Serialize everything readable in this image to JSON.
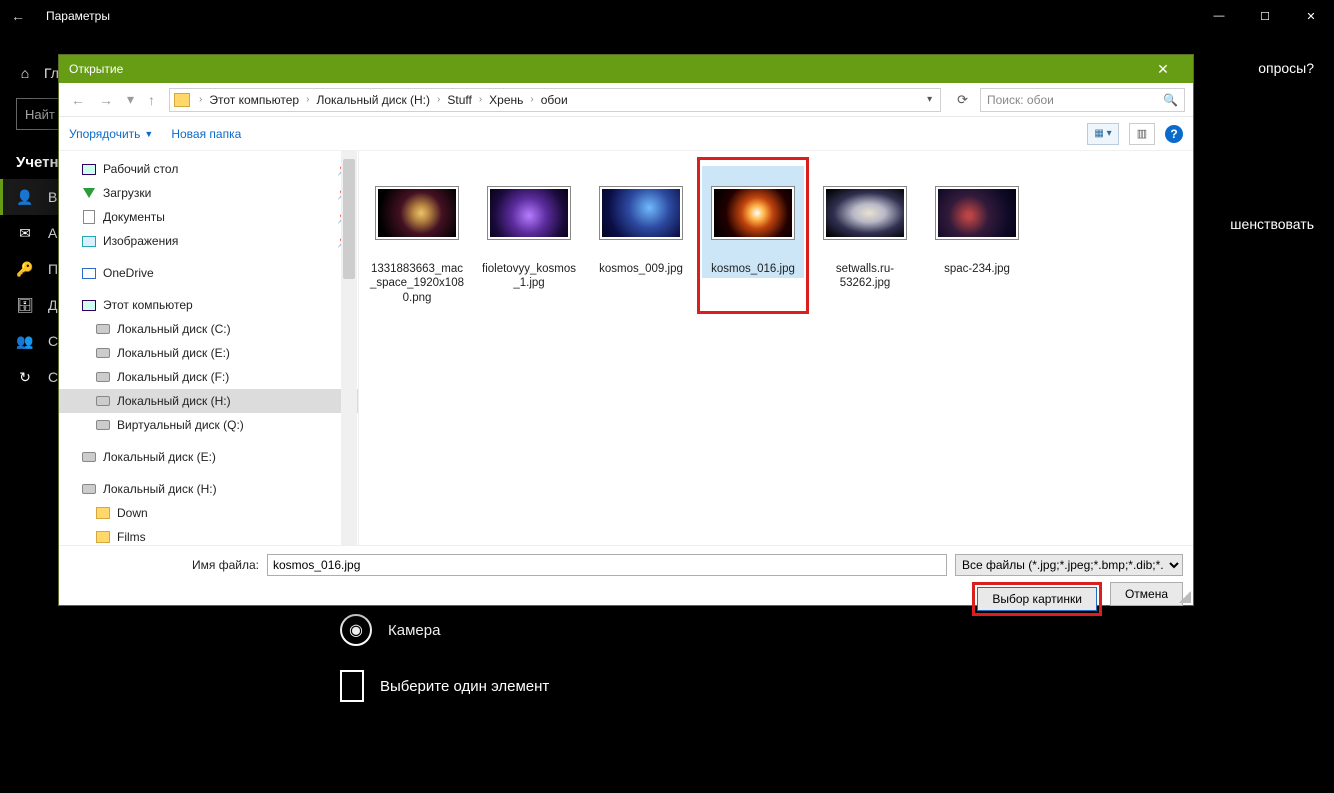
{
  "settings": {
    "window_title": "Параметры",
    "home_label": "Гл",
    "find_placeholder": "Найт",
    "section_head": "Учетн",
    "items": [
      {
        "icon": "user-icon",
        "label": "Ва"
      },
      {
        "icon": "mail-icon",
        "label": "А\nпр"
      },
      {
        "icon": "key-icon",
        "label": "Па"
      },
      {
        "icon": "briefcase-icon",
        "label": "Д\nил"
      },
      {
        "icon": "people-icon",
        "label": "Се"
      },
      {
        "icon": "sync-icon",
        "label": "Си"
      }
    ],
    "right_hint1": "опросы?",
    "right_hint2": "шенствовать"
  },
  "bottom": {
    "camera_label": "Камера",
    "select_label": "Выберите один элемент"
  },
  "dialog": {
    "title": "Открытие",
    "breadcrumbs": [
      "Этот компьютер",
      "Локальный диск (H:)",
      "Stuff",
      "Хрень",
      "обои"
    ],
    "search_placeholder": "Поиск: обои",
    "organize_label": "Упорядочить",
    "new_folder_label": "Новая папка",
    "tree": [
      {
        "icon": "desktop",
        "label": "Рабочий стол",
        "indent": 22,
        "pin": true
      },
      {
        "icon": "dl",
        "label": "Загрузки",
        "indent": 22,
        "pin": true
      },
      {
        "icon": "doc",
        "label": "Документы",
        "indent": 22,
        "pin": true
      },
      {
        "icon": "img",
        "label": "Изображения",
        "indent": 22,
        "pin": true
      },
      {
        "spacer": true
      },
      {
        "icon": "od",
        "label": "OneDrive",
        "indent": 22
      },
      {
        "spacer": true
      },
      {
        "icon": "pc",
        "label": "Этот компьютер",
        "indent": 22
      },
      {
        "icon": "disk",
        "label": "Локальный диск (C:)",
        "indent": 36
      },
      {
        "icon": "disk",
        "label": "Локальный диск (E:)",
        "indent": 36
      },
      {
        "icon": "disk",
        "label": "Локальный диск (F:)",
        "indent": 36
      },
      {
        "icon": "disk",
        "label": "Локальный диск (H:)",
        "indent": 36,
        "selected": true
      },
      {
        "icon": "disk",
        "label": "Виртуальный диск (Q:)",
        "indent": 36
      },
      {
        "spacer": true
      },
      {
        "icon": "disk",
        "label": "Локальный диск (E:)",
        "indent": 22
      },
      {
        "spacer": true
      },
      {
        "icon": "disk",
        "label": "Локальный диск (H:)",
        "indent": 22
      },
      {
        "icon": "fold",
        "label": "Down",
        "indent": 36
      },
      {
        "icon": "fold",
        "label": "Films",
        "indent": 36
      }
    ],
    "files": [
      {
        "name": "1331883663_mac_space_1920x1080.png",
        "thumb": "th0"
      },
      {
        "name": "fioletovyy_kosmos_1.jpg",
        "thumb": "th1"
      },
      {
        "name": "kosmos_009.jpg",
        "thumb": "th2"
      },
      {
        "name": "kosmos_016.jpg",
        "thumb": "th3",
        "selected": true
      },
      {
        "name": "setwalls.ru-53262.jpg",
        "thumb": "th4"
      },
      {
        "name": "spac-234.jpg",
        "thumb": "th5"
      }
    ],
    "filename_label": "Имя файла:",
    "filename_value": "kosmos_016.jpg",
    "filetype_value": "Все файлы (*.jpg;*.jpeg;*.bmp;*.dib;*.p",
    "ok_label": "Выбор картинки",
    "cancel_label": "Отмена"
  }
}
